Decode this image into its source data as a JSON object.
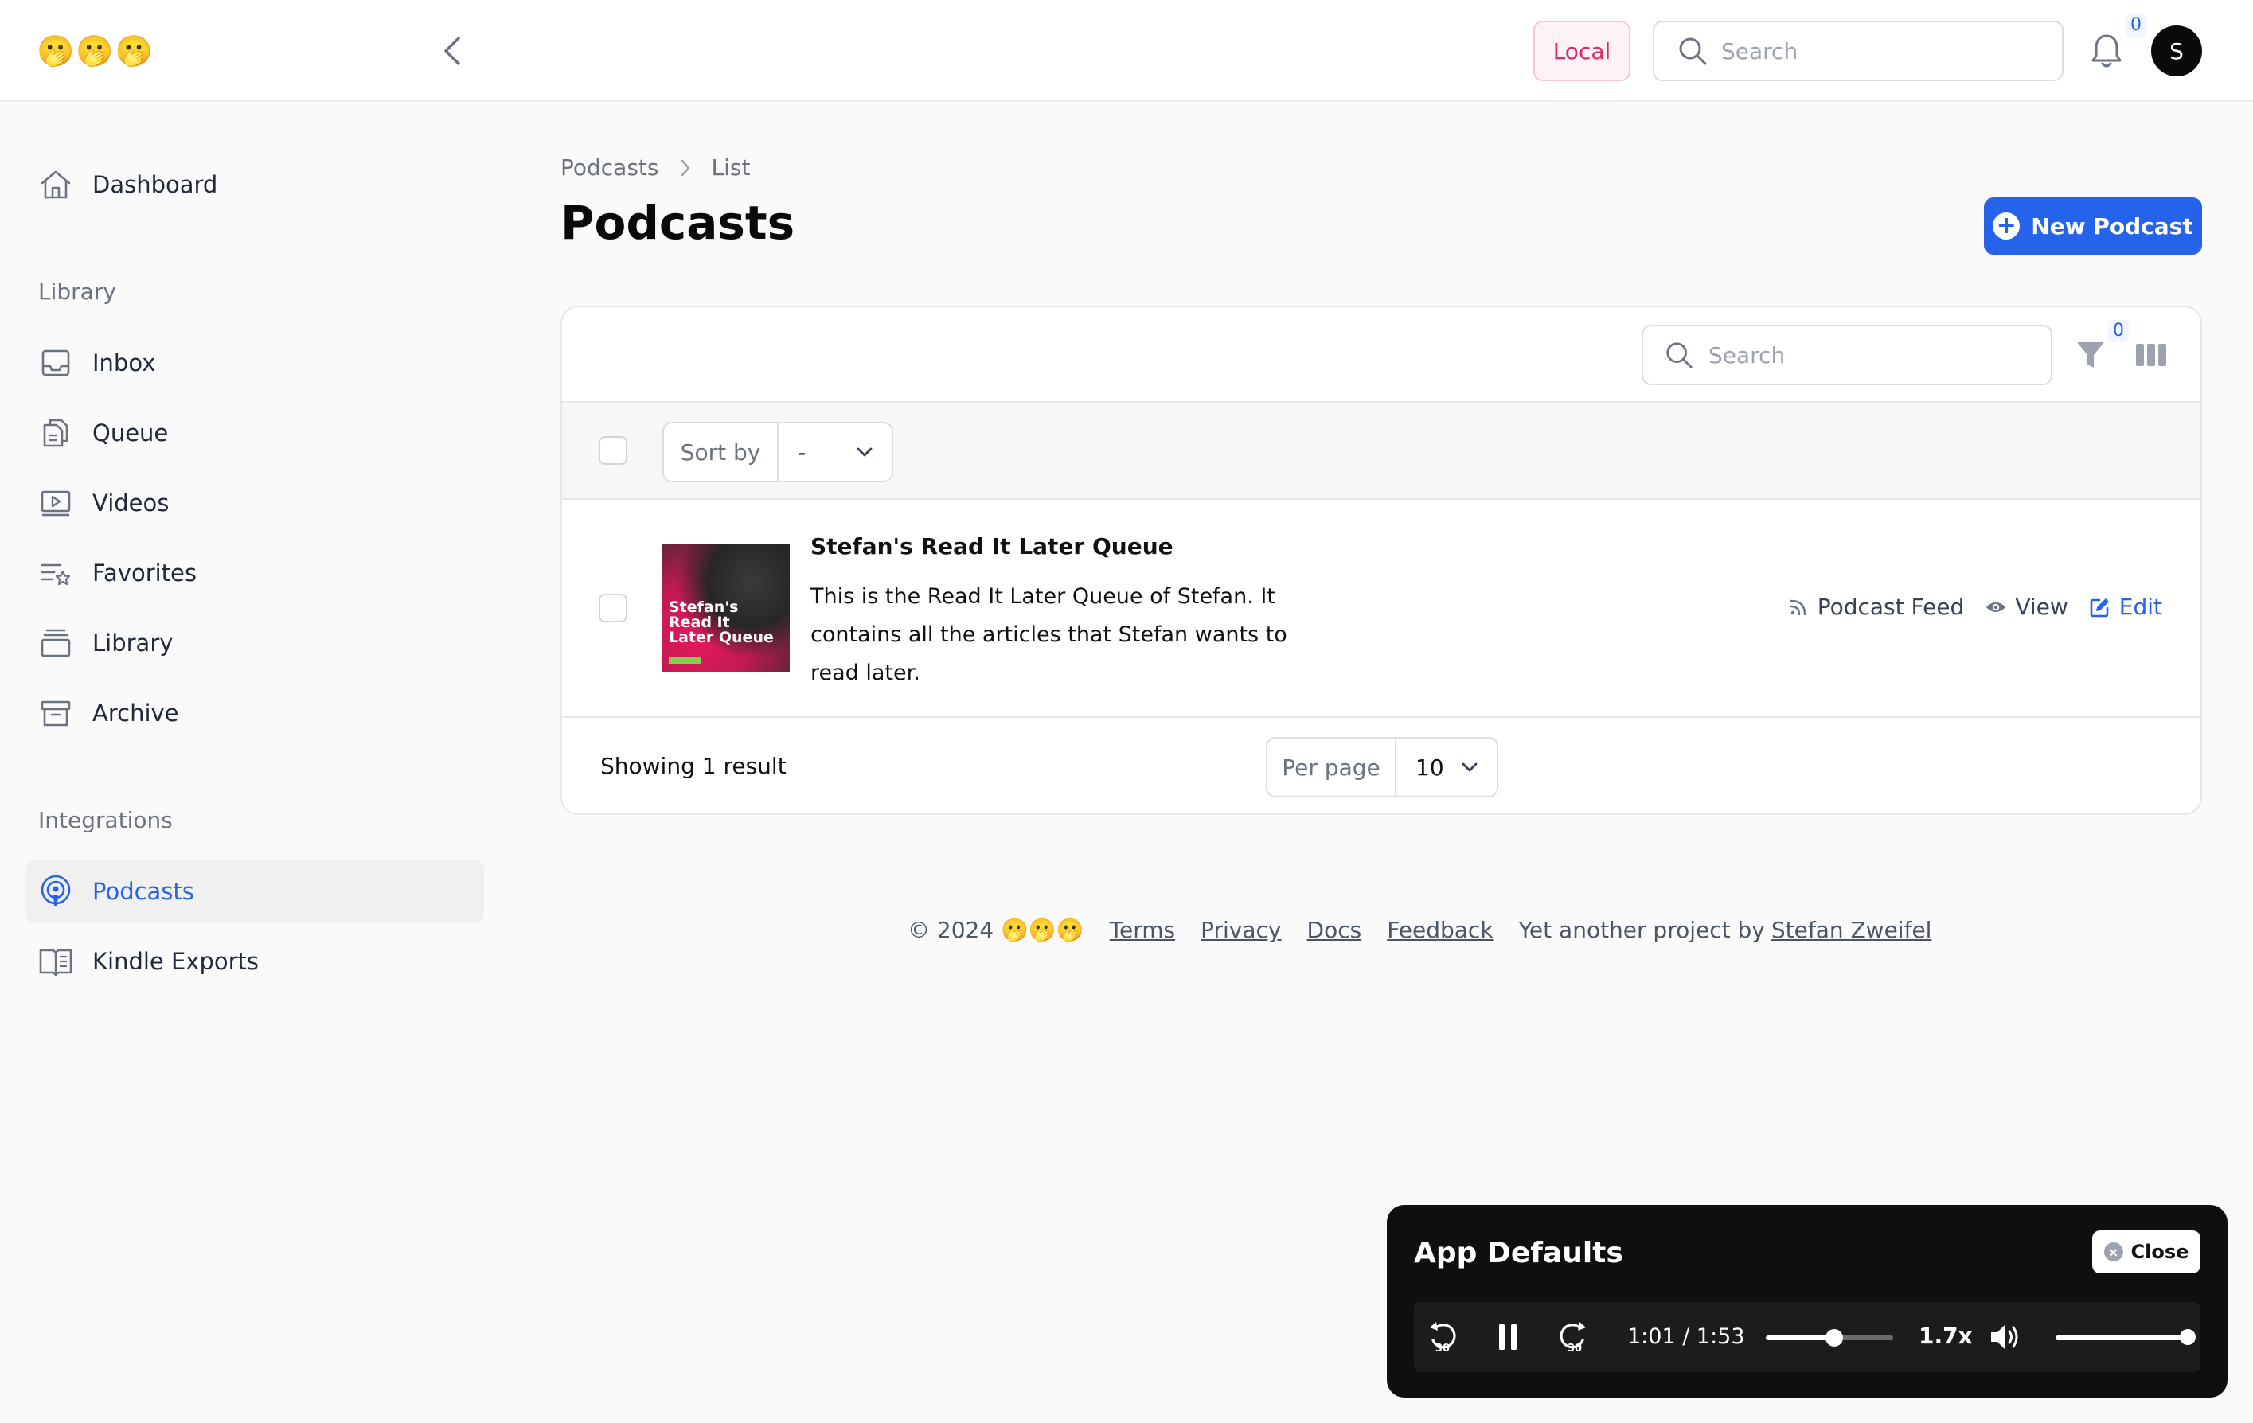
{
  "app": {
    "logo": "🫢🫢🫢"
  },
  "header": {
    "environment": "Local",
    "search_placeholder": "Search",
    "notification_count": "0",
    "avatar_initial": "S"
  },
  "sidebar": {
    "dashboard": "Dashboard",
    "library_group": "Library",
    "library_items": [
      "Inbox",
      "Queue",
      "Videos",
      "Favorites",
      "Library",
      "Archive"
    ],
    "integrations_group": "Integrations",
    "integration_items": [
      "Podcasts",
      "Kindle Exports"
    ],
    "active_item": "Podcasts"
  },
  "page": {
    "breadcrumb": [
      "Podcasts",
      "List"
    ],
    "title": "Podcasts",
    "new_button": "New Podcast"
  },
  "table": {
    "search_placeholder": "Search",
    "filter_count": "0",
    "sort_label": "Sort by",
    "sort_value": "-",
    "rows": [
      {
        "cover_text": "Stefan's Read It Later Queue",
        "title": "Stefan's Read It Later Queue",
        "description": "This is the Read It Later Queue of Stefan. It contains all the articles that Stefan wants to read later.",
        "actions": {
          "feed": "Podcast Feed",
          "view": "View",
          "edit": "Edit"
        }
      }
    ],
    "result_summary": "Showing 1 result",
    "per_page_label": "Per page",
    "per_page_value": "10"
  },
  "footer": {
    "copyright": "© 2024 🫢🫢🫢",
    "links": [
      "Terms",
      "Privacy",
      "Docs",
      "Feedback"
    ],
    "credit_prefix": "Yet another project by",
    "credit_name": "Stefan Zweifel"
  },
  "player": {
    "title": "App Defaults",
    "close_label": "Close",
    "time": "1:01 / 1:53",
    "progress_fraction": 0.54,
    "speed": "1.7x",
    "volume_fraction": 1.0,
    "skip_back_seconds": "30",
    "skip_forward_seconds": "30"
  },
  "colors": {
    "accent": "#2563eb",
    "env_badge": "#db2765",
    "player_bg": "#0f0f10"
  }
}
